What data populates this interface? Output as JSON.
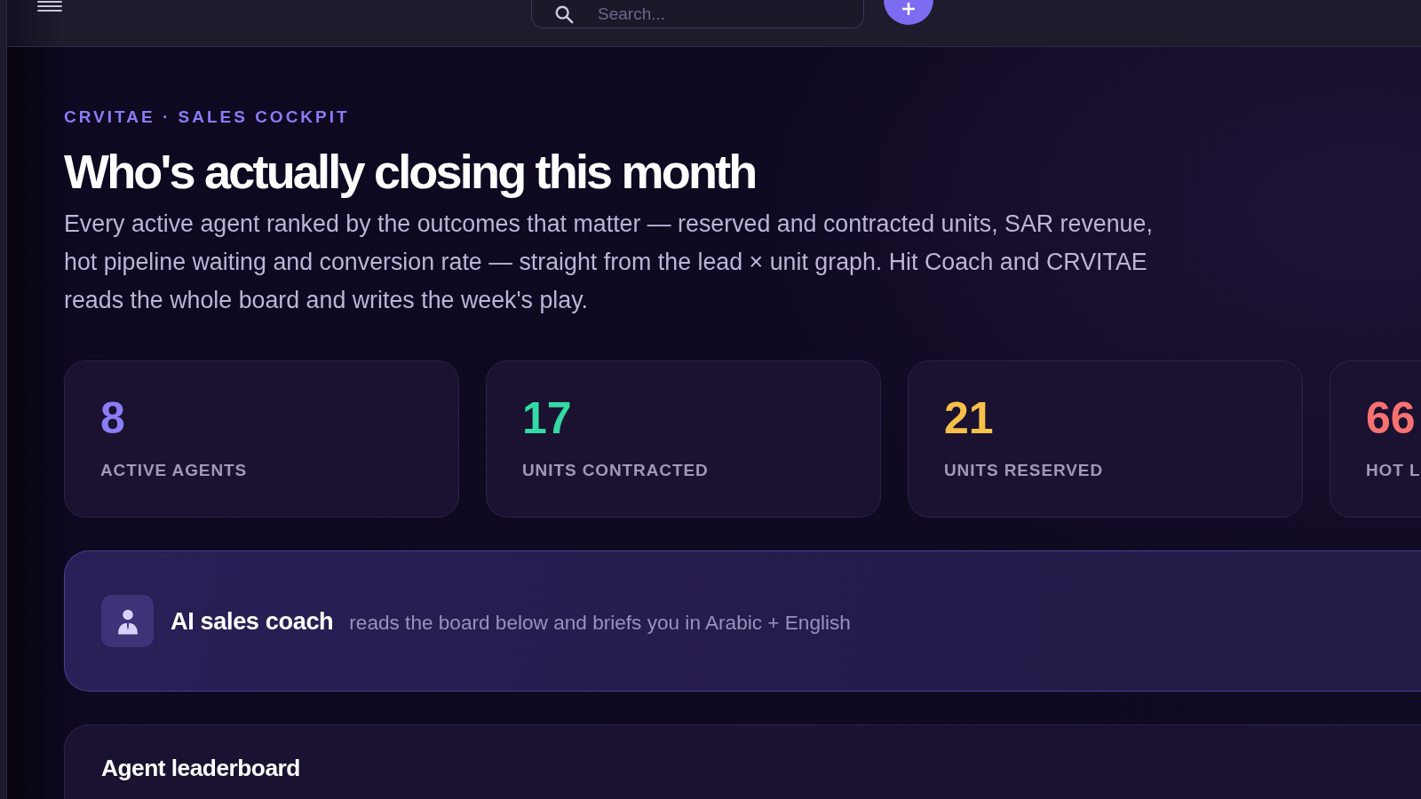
{
  "top_bar": {
    "search": {
      "placeholder": "Search..."
    }
  },
  "header": {
    "eyebrow": "CRVITAE · SALES COCKPIT",
    "title": "Who's actually closing this month",
    "description": "Every active agent ranked by the outcomes that matter — reserved and contracted units, SAR revenue, hot pipeline waiting and conversion rate — straight from the lead × unit graph. Hit Coach and CRVITAE reads the whole board and writes the week's play."
  },
  "stats": [
    {
      "value": "8",
      "label": "ACTIVE AGENTS",
      "color": "#8b7cf6"
    },
    {
      "value": "17",
      "label": "UNITS CONTRACTED",
      "color": "#34d9a5"
    },
    {
      "value": "21",
      "label": "UNITS RESERVED",
      "color": "#f5c14b"
    },
    {
      "value": "66",
      "label": "HOT L",
      "color": "#f87171"
    }
  ],
  "coach_banner": {
    "title": "AI sales coach",
    "subtitle": "reads the board below and briefs you in Arabic + English"
  },
  "leaderboard": {
    "title": "Agent leaderboard"
  }
}
